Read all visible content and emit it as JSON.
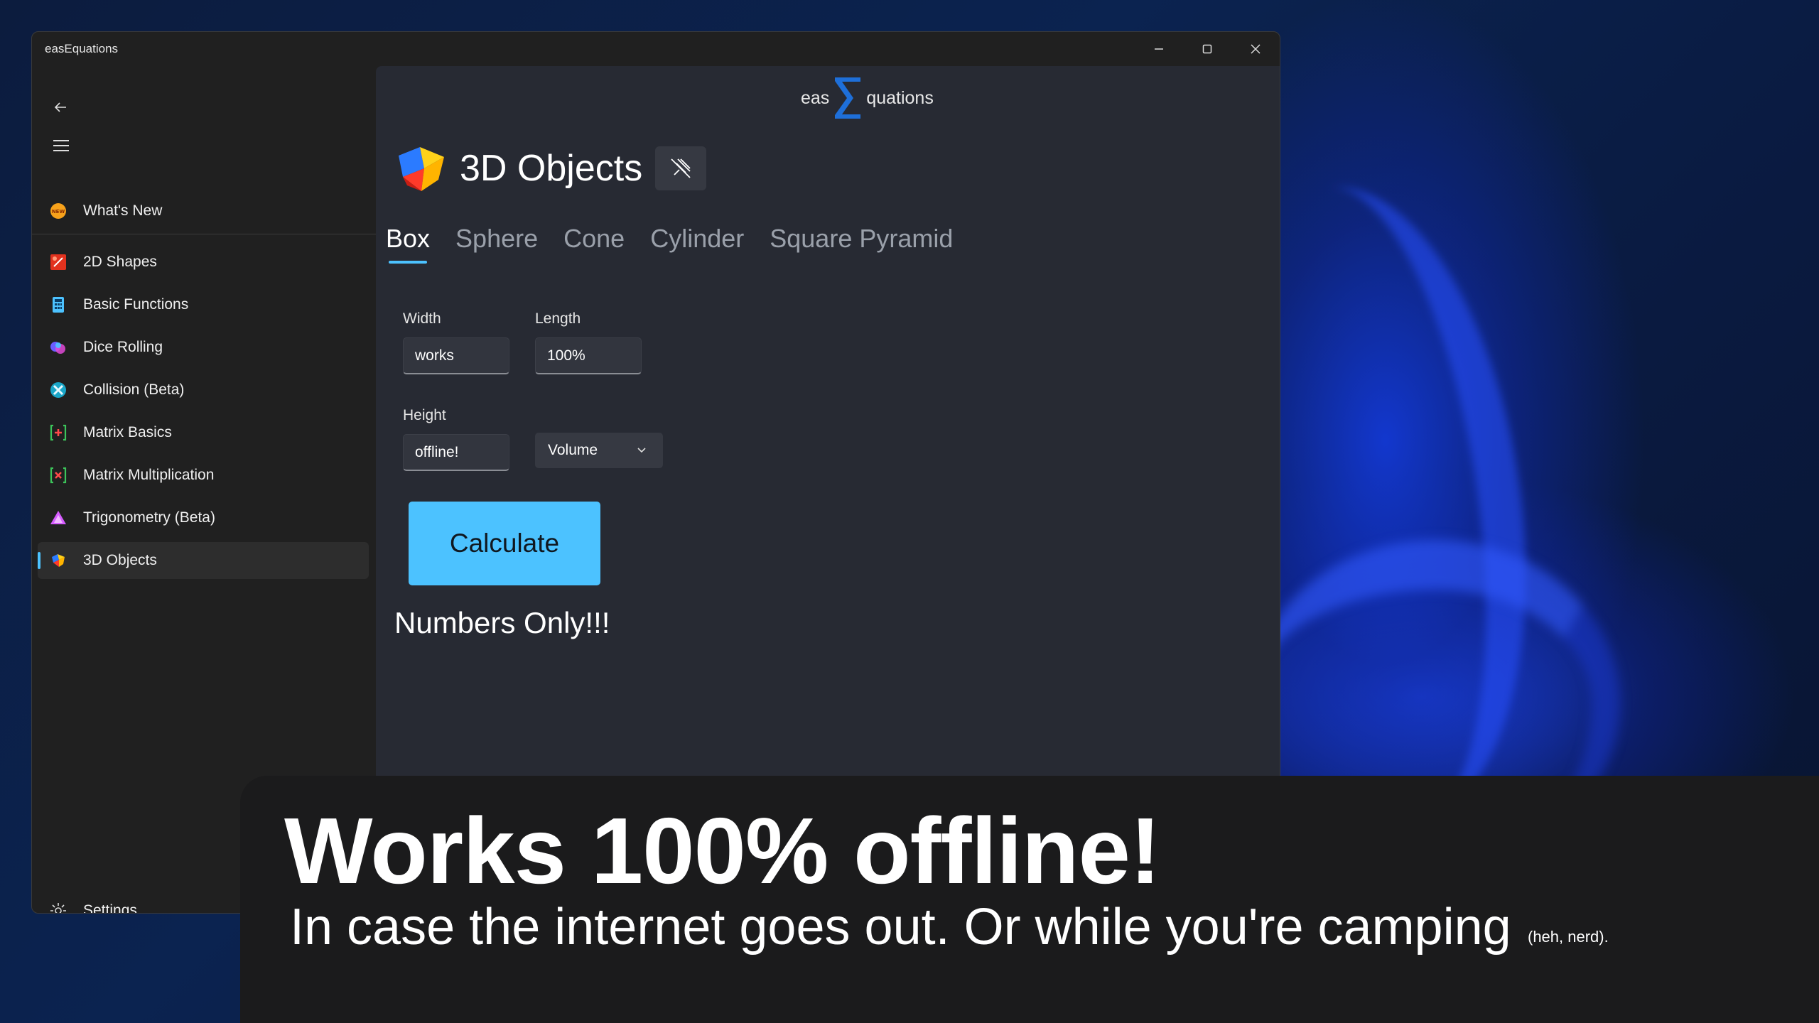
{
  "window": {
    "title": "easEquations",
    "controls": {
      "minimize": "—",
      "maximize": "☐",
      "close": "✕"
    }
  },
  "sidebar": {
    "items": [
      {
        "label": "What's New",
        "icon": "new-badge-icon"
      },
      {
        "label": "2D Shapes",
        "icon": "shapes-2d-icon"
      },
      {
        "label": "Basic Functions",
        "icon": "calculator-icon"
      },
      {
        "label": "Dice Rolling",
        "icon": "dice-icon"
      },
      {
        "label": "Collision (Beta)",
        "icon": "collision-icon"
      },
      {
        "label": "Matrix Basics",
        "icon": "matrix-plus-icon"
      },
      {
        "label": "Matrix Multiplication",
        "icon": "matrix-times-icon"
      },
      {
        "label": "Trigonometry (Beta)",
        "icon": "triangle-icon"
      },
      {
        "label": "3D Objects",
        "icon": "cube-icon",
        "selected": true
      }
    ],
    "settings_label": "Settings"
  },
  "brand": {
    "left": "eas",
    "right": "quations"
  },
  "page": {
    "title": "3D Objects",
    "tabs": [
      "Box",
      "Sphere",
      "Cone",
      "Cylinder",
      "Square Pyramid"
    ],
    "active_tab": "Box"
  },
  "form": {
    "width_label": "Width",
    "width_value": "works",
    "length_label": "Length",
    "length_value": "100%",
    "height_label": "Height",
    "height_value": "offline!",
    "mode_value": "Volume",
    "calculate_label": "Calculate",
    "result": "Numbers Only!!!"
  },
  "banner": {
    "headline": "Works 100% offline!",
    "subline": "In case the internet goes out. Or while you're camping",
    "note": "(heh, nerd)."
  },
  "colors": {
    "accent": "#4cc2ff",
    "content_bg": "#272a33",
    "sidebar_bg": "#202020",
    "banner_bg": "#1b1b1c"
  }
}
